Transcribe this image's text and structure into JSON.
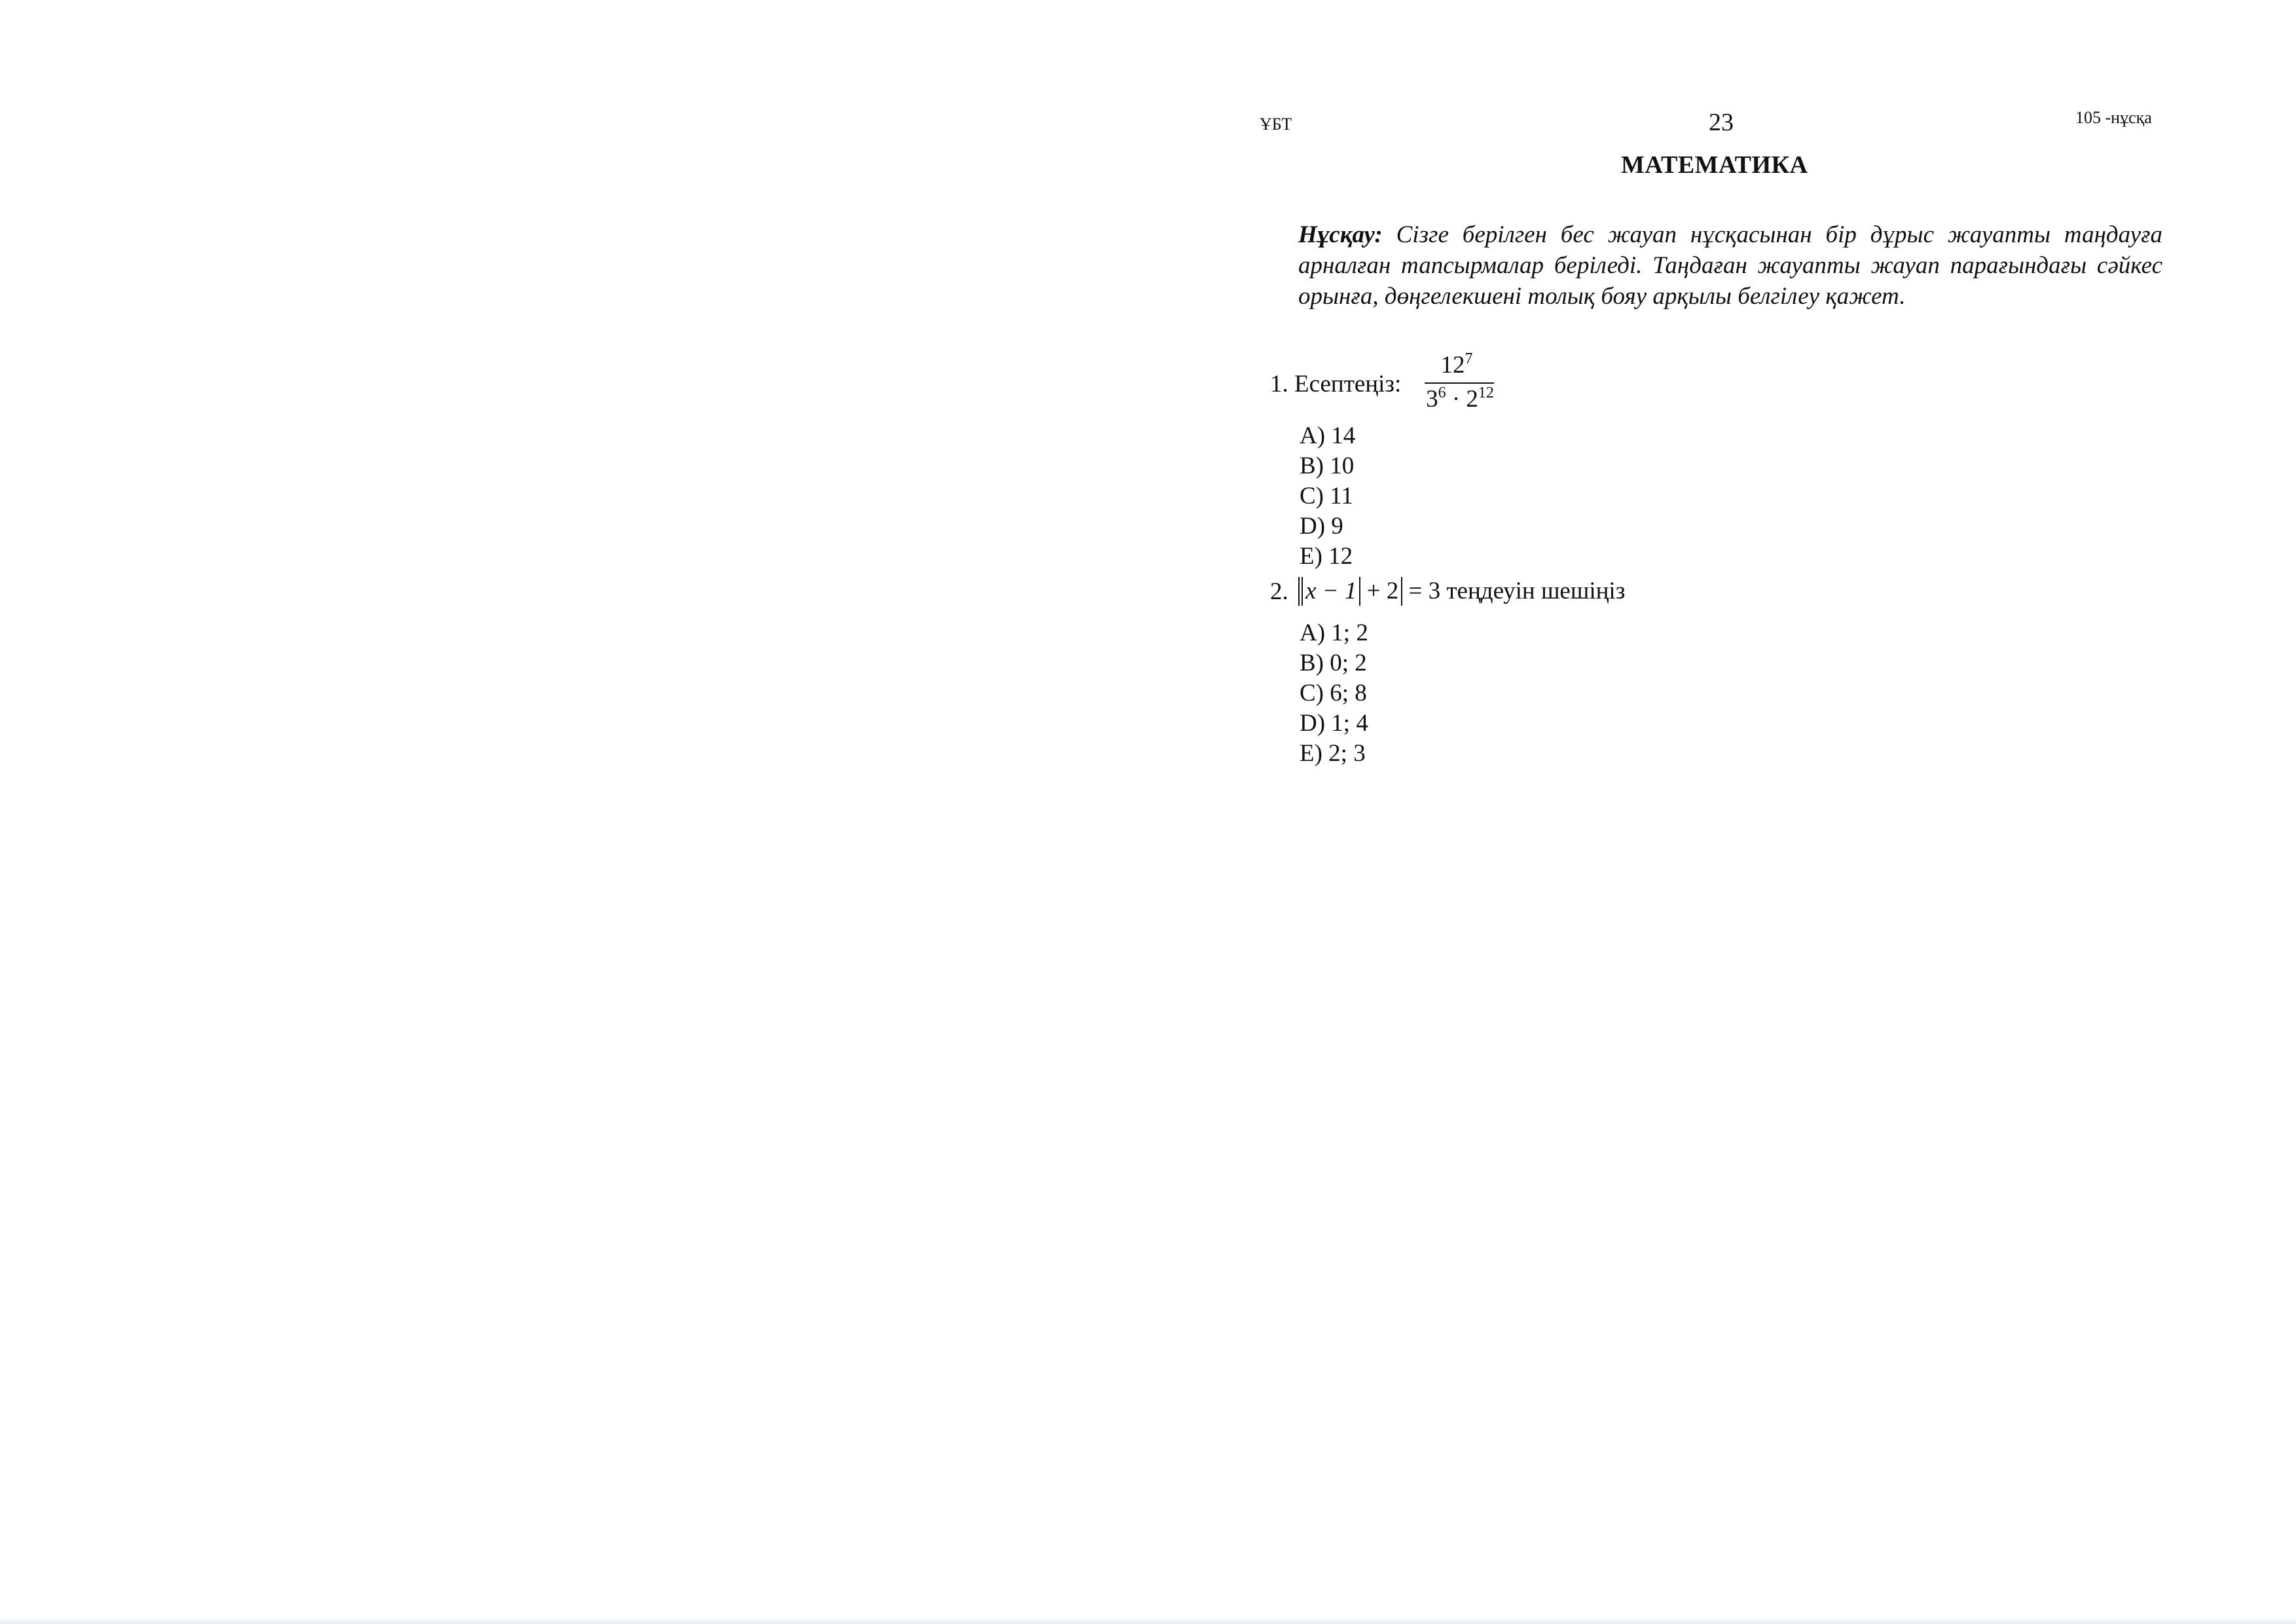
{
  "header": {
    "left": "ҰБТ",
    "page_number": "23",
    "variant": "105 -нұсқа"
  },
  "title": "МАТЕМАТИКА",
  "instruction": {
    "label": "Нұсқау:",
    "text": "Сізге берілген бес жауап нұсқасынан бір дұрыс жауапты таңдауға арналған тапсырмалар беріледі. Таңдаған жауапты жауап парағындағы сәйкес орынға, дөңгелекшені толық бояу арқылы белгілеу қажет."
  },
  "questions": [
    {
      "prompt": "1. Есептеңіз:",
      "fraction": {
        "num_base": "12",
        "num_exp": "7",
        "den_a_base": "3",
        "den_a_exp": "6",
        "den_dot": "·",
        "den_b_base": "2",
        "den_b_exp": "12"
      },
      "options": [
        "A) 14",
        "B) 10",
        "C) 11",
        "D) 9",
        "E) 12"
      ]
    },
    {
      "number": "2.",
      "equation": {
        "inner": "x − 1",
        "plus": "+ 2",
        "rhs": "= 3"
      },
      "suffix": "теңдеуін шешіңіз",
      "options": [
        "A) 1; 2",
        "B) 0; 2",
        "C) 6; 8",
        "D) 1; 4",
        "E) 2; 3"
      ]
    }
  ]
}
